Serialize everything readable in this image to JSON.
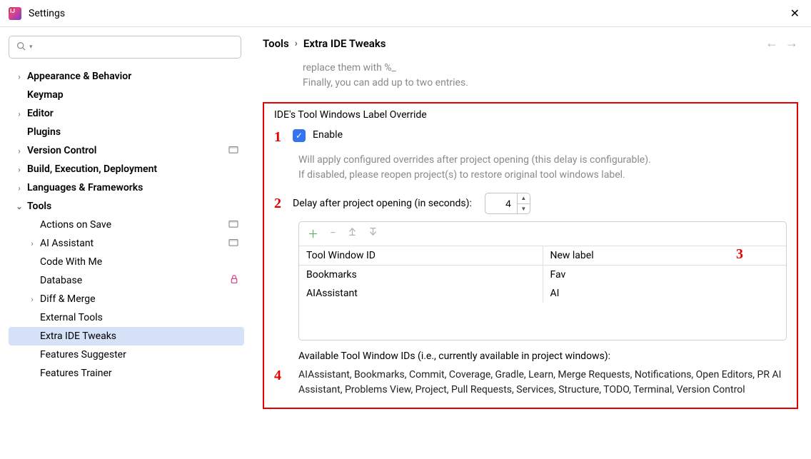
{
  "window": {
    "title": "Settings"
  },
  "breadcrumb": {
    "root": "Tools",
    "leaf": "Extra IDE Tweaks"
  },
  "sidebar": {
    "items": [
      {
        "label": "Appearance & Behavior",
        "bold": true,
        "chevron": "›",
        "indent": 0
      },
      {
        "label": "Keymap",
        "bold": true,
        "chevron": "",
        "indent": 0
      },
      {
        "label": "Editor",
        "bold": true,
        "chevron": "›",
        "indent": 0
      },
      {
        "label": "Plugins",
        "bold": true,
        "chevron": "",
        "indent": 0
      },
      {
        "label": "Version Control",
        "bold": true,
        "chevron": "›",
        "indent": 0,
        "trail": true
      },
      {
        "label": "Build, Execution, Deployment",
        "bold": true,
        "chevron": "›",
        "indent": 0
      },
      {
        "label": "Languages & Frameworks",
        "bold": true,
        "chevron": "›",
        "indent": 0
      },
      {
        "label": "Tools",
        "bold": true,
        "chevron": "⌄",
        "indent": 0
      },
      {
        "label": "Actions on Save",
        "bold": false,
        "chevron": "",
        "indent": 1,
        "trail": true
      },
      {
        "label": "AI Assistant",
        "bold": false,
        "chevron": "›",
        "indent": 1,
        "trail": true
      },
      {
        "label": "Code With Me",
        "bold": false,
        "chevron": "",
        "indent": 1
      },
      {
        "label": "Database",
        "bold": false,
        "chevron": "",
        "indent": 1,
        "lock": true
      },
      {
        "label": "Diff & Merge",
        "bold": false,
        "chevron": "›",
        "indent": 1
      },
      {
        "label": "External Tools",
        "bold": false,
        "chevron": "",
        "indent": 1
      },
      {
        "label": "Extra IDE Tweaks",
        "bold": false,
        "chevron": "",
        "indent": 1,
        "selected": true
      },
      {
        "label": "Features Suggester",
        "bold": false,
        "chevron": "",
        "indent": 1
      },
      {
        "label": "Features Trainer",
        "bold": false,
        "chevron": "",
        "indent": 1
      }
    ]
  },
  "hint": {
    "line1": "replace them with %_",
    "line2": "Finally, you can add up to two entries."
  },
  "section": {
    "title": "IDE's Tool Windows Label Override",
    "enable_label": "Enable",
    "enable_checked": true,
    "desc1": "Will apply configured overrides after project opening (this delay is configurable).",
    "desc2": "If disabled, please reopen project(s) to restore original tool windows label.",
    "delay_label": "Delay after project opening (in seconds):",
    "delay_value": "4",
    "table": {
      "col1": "Tool Window ID",
      "col2": "New label",
      "rows": [
        {
          "id": "Bookmarks",
          "label": "Fav"
        },
        {
          "id": "AIAssistant",
          "label": "AI"
        }
      ]
    },
    "avail_title": "Available Tool Window IDs (i.e., currently available in project windows):",
    "avail_list": "AIAssistant, Bookmarks, Commit, Coverage, Gradle, Learn, Merge Requests, Notifications, Open Editors, PR AI Assistant, Problems View, Project, Pull Requests, Services, Structure, TODO, Terminal, Version Control"
  },
  "callouts": {
    "c1": "1",
    "c2": "2",
    "c3": "3",
    "c4": "4"
  }
}
